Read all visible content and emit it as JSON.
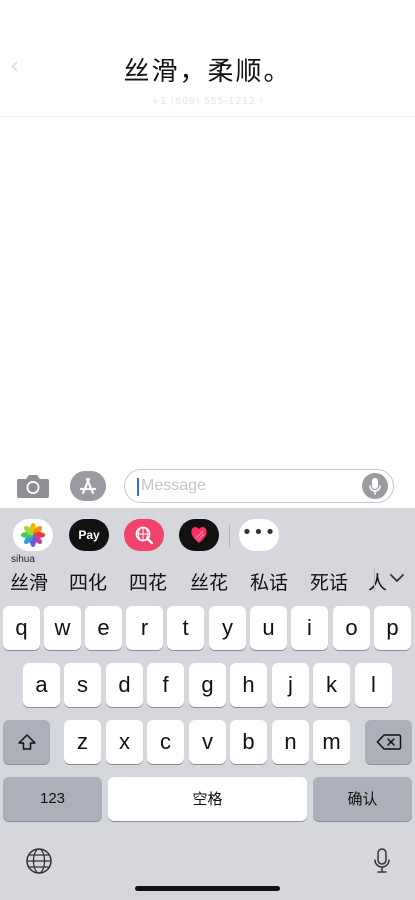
{
  "header": {
    "contact_number": "+1 (609) 555-1212 ›",
    "overlay_caption": "丝滑，柔顺。"
  },
  "composer": {
    "placeholder": "Message"
  },
  "app_strip": {
    "apps": [
      {
        "name": "Photos",
        "icon": "photos-icon"
      },
      {
        "name": "Apple Pay",
        "label": "Pay",
        "icon": "apple-pay-icon"
      },
      {
        "name": "Images Search",
        "icon": "globe-search-icon"
      },
      {
        "name": "Digital Touch",
        "icon": "heart-icon"
      },
      {
        "name": "More",
        "label": "•••",
        "icon": "more-icon"
      }
    ]
  },
  "keyboard": {
    "pinyin": "sihua",
    "candidates": [
      "丝滑",
      "四化",
      "四花",
      "丝花",
      "私话",
      "死话"
    ],
    "candidates_overflow": "人",
    "row1": [
      "q",
      "w",
      "e",
      "r",
      "t",
      "y",
      "u",
      "i",
      "o",
      "p"
    ],
    "row2": [
      "a",
      "s",
      "d",
      "f",
      "g",
      "h",
      "j",
      "k",
      "l"
    ],
    "row3": [
      "z",
      "x",
      "c",
      "v",
      "b",
      "n",
      "m"
    ],
    "numbers_key": "123",
    "space_key": "空格",
    "confirm_key": "确认"
  },
  "colors": {
    "keyboard_bg": "#d5d7dd",
    "special_key": "#abb0ba",
    "cursor": "#2f6fec",
    "search_app": "#f0426a"
  }
}
